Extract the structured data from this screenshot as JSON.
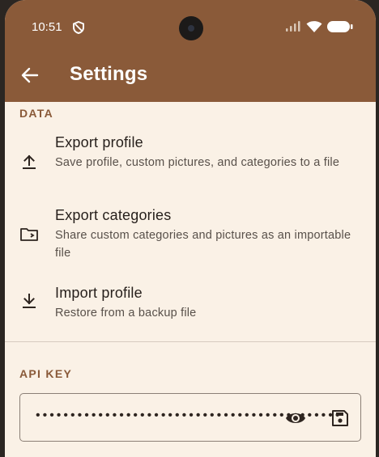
{
  "status_bar": {
    "time": "10:51"
  },
  "app_bar": {
    "title": "Settings"
  },
  "data_section": {
    "title": "DATA",
    "items": [
      {
        "title": "Export profile",
        "subtitle": "Save profile, custom pictures, and categories to a file",
        "icon": "upload-icon"
      },
      {
        "title": "Export categories",
        "subtitle": "Share custom categories and pictures as an importable file",
        "icon": "folder-icon"
      },
      {
        "title": "Import profile",
        "subtitle": "Restore from a backup file",
        "icon": "download-icon"
      }
    ]
  },
  "api_section": {
    "title": "API KEY",
    "key_value": "••••••••••••••••••••••••••••••••••••••••••••",
    "icons": [
      "eye-icon",
      "save-icon"
    ]
  },
  "colors": {
    "header": "#8a5a39",
    "background": "#faf1e6",
    "accent": "#8a5a39"
  }
}
